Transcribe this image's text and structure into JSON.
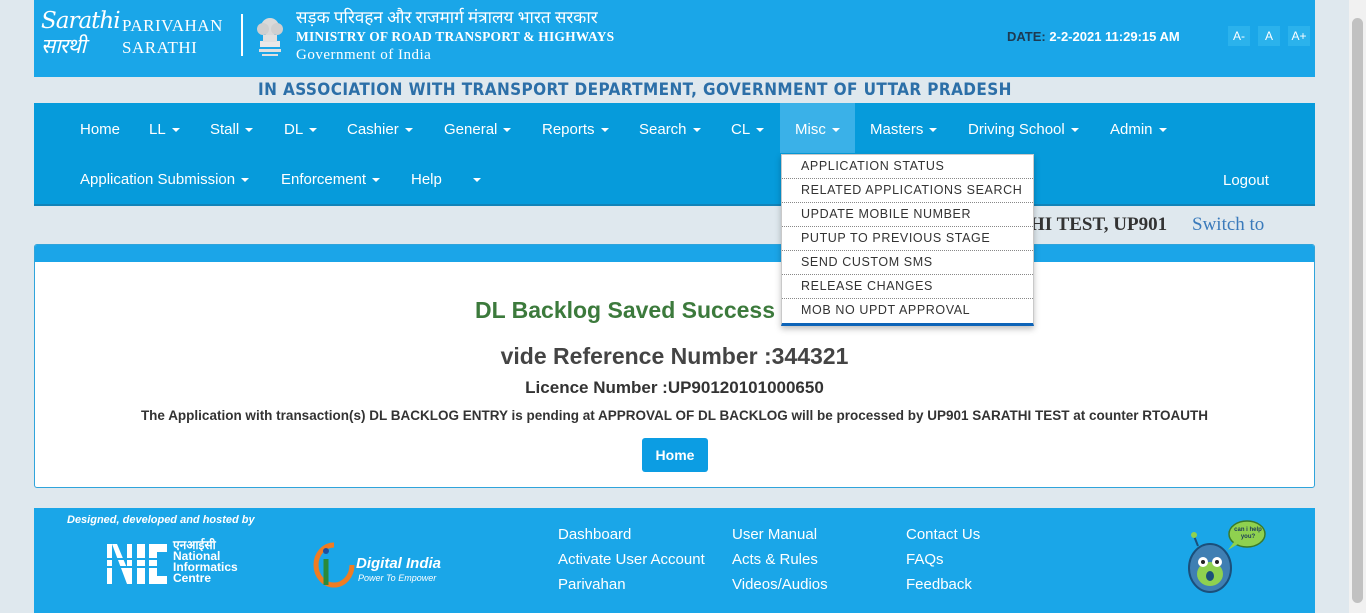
{
  "header": {
    "logo_line1": "Sarathi",
    "logo_line2": "सारथी",
    "parivahan": "PARIVAHAN",
    "sarathi": "SARATHI",
    "ministry_hindi": "सड़क परिवहन और राजमार्ग मंत्रालय भारत सरकार",
    "ministry_english": "MINISTRY OF ROAD TRANSPORT & HIGHWAYS",
    "government": "Government of India",
    "date_label": "DATE:",
    "date_value": "2-2-2021 11:29:15 AM",
    "font_small": "A-",
    "font_normal": "A",
    "font_large": "A+"
  },
  "association": "IN ASSOCIATION WITH TRANSPORT DEPARTMENT, GOVERNMENT OF UTTAR PRADESH",
  "nav": {
    "row1": [
      "Home",
      "LL",
      "Stall",
      "DL",
      "Cashier",
      "General",
      "Reports",
      "Search",
      "CL",
      "Misc",
      "Masters",
      "Driving School",
      "Admin"
    ],
    "row2": [
      "Application Submission",
      "Enforcement",
      "Help"
    ],
    "logout": "Logout"
  },
  "misc_menu": [
    "APPLICATION STATUS",
    "RELATED APPLICATIONS SEARCH",
    "UPDATE MOBILE NUMBER",
    "PUTUP TO PREVIOUS STAGE",
    "SEND CUSTOM SMS",
    "RELEASE CHANGES",
    "MOB NO UPDT APPROVAL"
  ],
  "user": {
    "name_partial": "HI TEST, UP901",
    "switch": "Switch to"
  },
  "result": {
    "title": "DL Backlog Saved Success",
    "reference": "vide Reference Number :344321",
    "licence": "Licence Number :UP90120101000650",
    "message": "The Application with transaction(s) DL BACKLOG ENTRY is pending at APPROVAL OF DL BACKLOG will be processed by UP901 SARATHI TEST at counter RTOAUTH",
    "home_button": "Home"
  },
  "footer": {
    "designed": "Designed, developed and hosted by",
    "nic_hindi": "एनआईसी",
    "nic_line1": "National",
    "nic_line2": "Informatics",
    "nic_line3": "Centre",
    "digital_india": "Digital India",
    "digital_tagline": "Power To Empower",
    "links_col1": [
      "Dashboard",
      "Activate User Account",
      "Parivahan"
    ],
    "links_col2": [
      "User Manual",
      "Acts & Rules",
      "Videos/Audios"
    ],
    "links_col3": [
      "Contact Us",
      "FAQs",
      "Feedback"
    ],
    "help_bubble": "can i help you?"
  }
}
